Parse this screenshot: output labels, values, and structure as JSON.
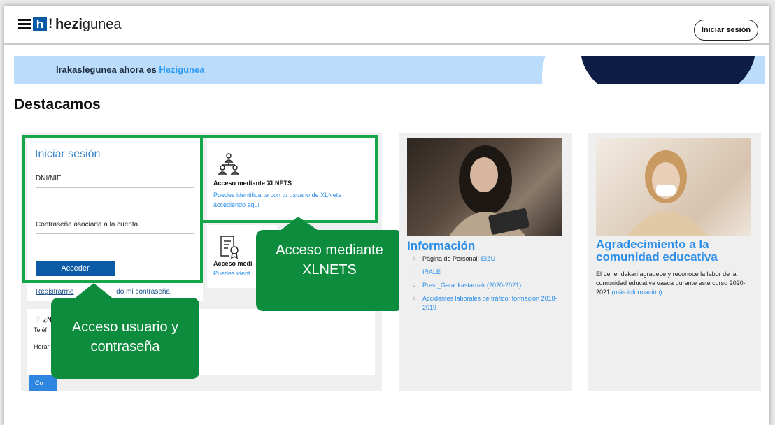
{
  "header": {
    "logo_letter": "h",
    "logo_excl": "!",
    "logo_bold": "hezi",
    "logo_rest": "gunea",
    "login_button": "Iniciar sesión"
  },
  "banner": {
    "text": "Irakaslegunea ahora es ",
    "accent": "Hezigunea"
  },
  "section_title": "Destacamos",
  "login_form": {
    "title": "Iniciar sesión",
    "dni_label": "DNI/NIE",
    "dni_value": "",
    "password_label": "Contraseña asociada a la cuenta",
    "password_value": "",
    "submit": "Acceder",
    "register_link": "Registrarme",
    "forgot_link_visible": "do mi contraseña"
  },
  "help": {
    "question": "¿N",
    "phone": "Teléf",
    "hours": "Horar",
    "button": "Co"
  },
  "xlnets": {
    "title": "Acceso mediante XLNETS",
    "description": "Puedes identificarte con tu usuario de XLNets accediendo aquí"
  },
  "certificate": {
    "title": "Acceso medi",
    "description": "Puedes ident"
  },
  "callouts": {
    "user_password": "Acceso  usuario y contraseña",
    "xlnets": "Acceso mediante XLNETS"
  },
  "info": {
    "title": "Información",
    "items": [
      {
        "prefix": "Página de Personal: ",
        "link": "EIZU"
      },
      {
        "prefix": "",
        "link": "IRALE"
      },
      {
        "prefix": "",
        "link": "Prest_Gara ikastaroak (2020-2021)"
      },
      {
        "prefix": "",
        "link": "Accidentes laborales de tráfico: formación 2018-2019"
      }
    ]
  },
  "agradecimiento": {
    "title": "Agradecimiento a la comunidad educativa",
    "body": "El Lehendakari agradece y reconoce la labor de la comunidad educativa vasca durante este curso 2020-2021 ",
    "link": "(más información)",
    "tail": "."
  },
  "colors": {
    "highlight_green": "#16a64a",
    "callout_green": "#0e8c3e",
    "link_blue": "#2d8ee8",
    "brand_blue": "#0b5aa6"
  }
}
